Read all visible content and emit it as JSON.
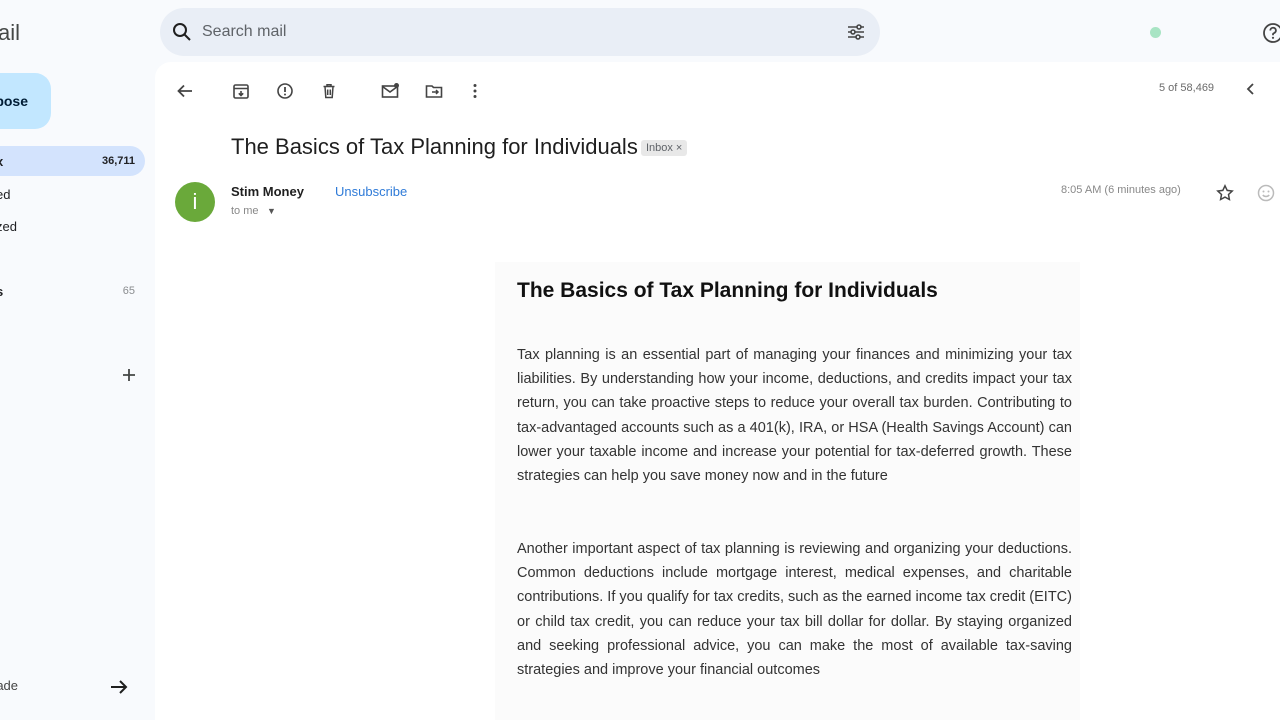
{
  "app": {
    "logo_text": "ail"
  },
  "sidebar": {
    "compose_label": "pose",
    "items": [
      {
        "label": "x",
        "count": "36,711"
      },
      {
        "label": "ed",
        "count": ""
      },
      {
        "label": "zed",
        "count": ""
      },
      {
        "label": "s",
        "count": "65"
      }
    ],
    "upgrade_label": "rade"
  },
  "search": {
    "placeholder": "Search mail"
  },
  "toolbar": {
    "pager_text": "5 of 58,469"
  },
  "email": {
    "subject": "The Basics of Tax Planning for Individuals",
    "label_chip": "Inbox",
    "label_chip_close": "×",
    "sender_name": "Stim Money",
    "sender_initial": "i",
    "unsubscribe_label": "Unsubscribe",
    "to_line": "to me",
    "time": "8:05 AM (6 minutes ago)",
    "body": {
      "title": "The Basics of Tax Planning for Individuals",
      "paragraphs": [
        "Tax planning is an essential part of managing your finances and minimizing your tax liabilities. By understanding how your income, deductions, and credits impact your tax return, you can take proactive steps to reduce your overall tax burden. Contributing to tax-advantaged accounts such as a 401(k), IRA, or HSA (Health Savings Account) can lower your taxable income and increase your potential for tax-deferred growth. These strategies can help you save money now and in the future",
        "Another important aspect of tax planning is reviewing and organizing your deductions. Common deductions include mortgage interest, medical expenses, and charitable contributions. If you qualify for tax credits, such as the earned income tax credit (EITC) or child tax credit, you can reduce your tax bill dollar for dollar. By staying organized and seeking professional advice, you can make the most of available tax-saving strategies and improve your financial outcomes"
      ]
    }
  },
  "colors": {
    "accent": "#2f7bd8",
    "avatar": "#6aa93a",
    "compose": "#c2e7ff",
    "active_nav": "#d3e3fd"
  },
  "icons": [
    "search-icon",
    "filter-icon",
    "help-icon",
    "back-icon",
    "archive-icon",
    "report-spam-icon",
    "delete-icon",
    "mark-unread-icon",
    "move-to-icon",
    "more-icon",
    "chevron-left-icon",
    "star-icon",
    "emoji-icon",
    "plus-icon",
    "arrow-right-icon"
  ]
}
